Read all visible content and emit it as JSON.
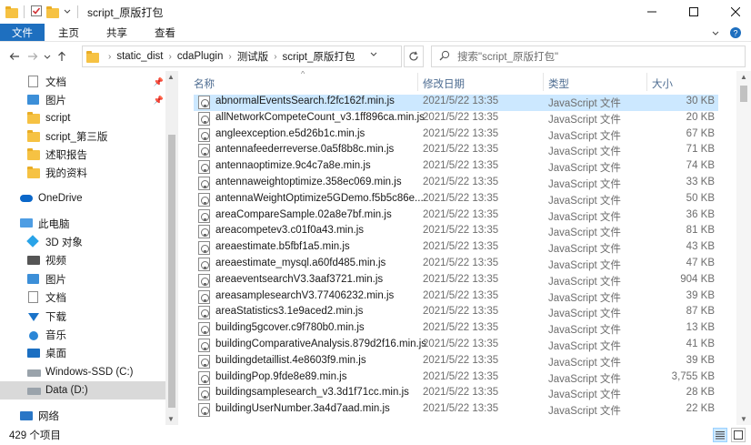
{
  "window": {
    "title": "script_原版打包"
  },
  "ribbon": {
    "tabs": [
      "文件",
      "主页",
      "共享",
      "查看"
    ]
  },
  "address": {
    "crumbs": [
      "static_dist",
      "cdaPlugin",
      "测试版",
      "script_原版打包"
    ]
  },
  "search": {
    "placeholder": "搜索\"script_原版打包\""
  },
  "sidebar": {
    "items": [
      {
        "label": "文档",
        "icon": "doc-icon",
        "pinned": true
      },
      {
        "label": "图片",
        "icon": "picture-icon",
        "pinned": true
      },
      {
        "label": "script",
        "icon": "folder-icon"
      },
      {
        "label": "script_第三版",
        "icon": "folder-icon"
      },
      {
        "label": "述职报告",
        "icon": "folder-icon"
      },
      {
        "label": "我的资料",
        "icon": "folder-icon"
      },
      {
        "label": "OneDrive",
        "icon": "onedrive-icon"
      },
      {
        "label": "此电脑",
        "icon": "this-pc-icon"
      },
      {
        "label": "3D 对象",
        "icon": "3d-objects-icon"
      },
      {
        "label": "视频",
        "icon": "video-icon"
      },
      {
        "label": "图片",
        "icon": "picture-icon"
      },
      {
        "label": "文档",
        "icon": "doc-icon"
      },
      {
        "label": "下载",
        "icon": "download-icon"
      },
      {
        "label": "音乐",
        "icon": "music-icon"
      },
      {
        "label": "桌面",
        "icon": "desktop-icon"
      },
      {
        "label": "Windows-SSD (C:)",
        "icon": "drive-icon"
      },
      {
        "label": "Data (D:)",
        "icon": "drive-icon",
        "selected": true
      },
      {
        "label": "网络",
        "icon": "network-icon"
      }
    ]
  },
  "columns": {
    "name": "名称",
    "date": "修改日期",
    "type": "类型",
    "size": "大小"
  },
  "files": [
    {
      "name": "abnormalEventsSearch.f2fc162f.min.js",
      "date": "2021/5/22 13:35",
      "type": "JavaScript 文件",
      "size": "30 KB",
      "selected": true
    },
    {
      "name": "allNetworkCompeteCount_v3.1ff896ca.min.js",
      "date": "2021/5/22 13:35",
      "type": "JavaScript 文件",
      "size": "20 KB"
    },
    {
      "name": "angleexception.e5d26b1c.min.js",
      "date": "2021/5/22 13:35",
      "type": "JavaScript 文件",
      "size": "67 KB"
    },
    {
      "name": "antennafeederreverse.0a5f8b8c.min.js",
      "date": "2021/5/22 13:35",
      "type": "JavaScript 文件",
      "size": "71 KB"
    },
    {
      "name": "antennaoptimize.9c4c7a8e.min.js",
      "date": "2021/5/22 13:35",
      "type": "JavaScript 文件",
      "size": "74 KB"
    },
    {
      "name": "antennaweightoptimize.358ec069.min.js",
      "date": "2021/5/22 13:35",
      "type": "JavaScript 文件",
      "size": "33 KB"
    },
    {
      "name": "antennaWeightOptimize5GDemo.f5b5c86e....",
      "date": "2021/5/22 13:35",
      "type": "JavaScript 文件",
      "size": "50 KB"
    },
    {
      "name": "areaCompareSample.02a8e7bf.min.js",
      "date": "2021/5/22 13:35",
      "type": "JavaScript 文件",
      "size": "36 KB"
    },
    {
      "name": "areacompetev3.c01f0a43.min.js",
      "date": "2021/5/22 13:35",
      "type": "JavaScript 文件",
      "size": "81 KB"
    },
    {
      "name": "areaestimate.b5fbf1a5.min.js",
      "date": "2021/5/22 13:35",
      "type": "JavaScript 文件",
      "size": "43 KB"
    },
    {
      "name": "areaestimate_mysql.a60fd485.min.js",
      "date": "2021/5/22 13:35",
      "type": "JavaScript 文件",
      "size": "47 KB"
    },
    {
      "name": "areaeventsearchV3.3aaf3721.min.js",
      "date": "2021/5/22 13:35",
      "type": "JavaScript 文件",
      "size": "904 KB"
    },
    {
      "name": "areasamplesearchV3.77406232.min.js",
      "date": "2021/5/22 13:35",
      "type": "JavaScript 文件",
      "size": "39 KB"
    },
    {
      "name": "areaStatistics3.1e9aced2.min.js",
      "date": "2021/5/22 13:35",
      "type": "JavaScript 文件",
      "size": "87 KB"
    },
    {
      "name": "building5gcover.c9f780b0.min.js",
      "date": "2021/5/22 13:35",
      "type": "JavaScript 文件",
      "size": "13 KB"
    },
    {
      "name": "buildingComparativeAnalysis.879d2f16.min.js",
      "date": "2021/5/22 13:35",
      "type": "JavaScript 文件",
      "size": "41 KB"
    },
    {
      "name": "buildingdetaillist.4e8603f9.min.js",
      "date": "2021/5/22 13:35",
      "type": "JavaScript 文件",
      "size": "39 KB"
    },
    {
      "name": "buildingPop.9fde8e89.min.js",
      "date": "2021/5/22 13:35",
      "type": "JavaScript 文件",
      "size": "3,755 KB"
    },
    {
      "name": "buildingsamplesearch_v3.3d1f71cc.min.js",
      "date": "2021/5/22 13:35",
      "type": "JavaScript 文件",
      "size": "28 KB"
    },
    {
      "name": "buildingUserNumber.3a4d7aad.min.js",
      "date": "2021/5/22 13:35",
      "type": "JavaScript 文件",
      "size": "22 KB"
    }
  ],
  "status": {
    "item_count": "429 个项目"
  }
}
